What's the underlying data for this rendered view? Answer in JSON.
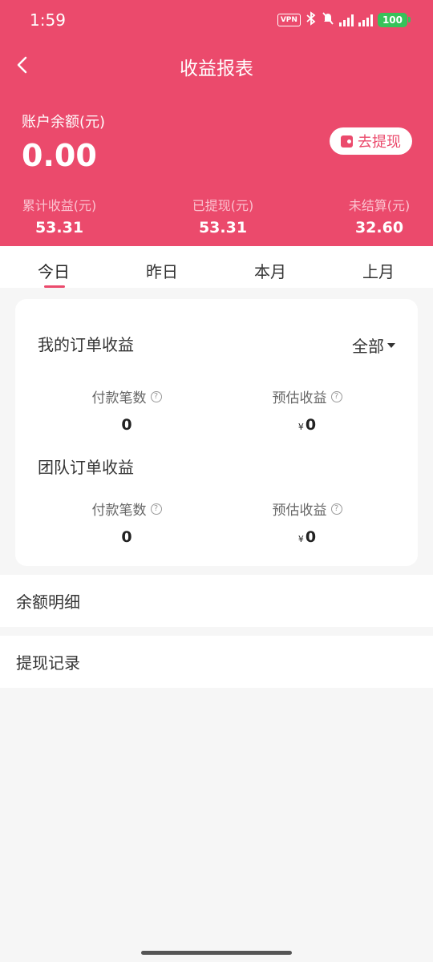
{
  "status_bar": {
    "time": "1:59",
    "vpn": "VPN",
    "battery": "100",
    "icons": [
      "vpn-icon",
      "bluetooth-icon",
      "mute-icon",
      "signal-icon",
      "signal-icon",
      "battery-icon"
    ]
  },
  "header": {
    "title": "收益报表",
    "back_icon": "chevron-left-icon",
    "balance_label": "账户余额(元)",
    "balance_value": "0.00",
    "withdraw_label": "去提现",
    "stats": [
      {
        "label": "累计收益(元)",
        "value": "53.31"
      },
      {
        "label": "已提现(元)",
        "value": "53.31"
      },
      {
        "label": "未结算(元)",
        "value": "32.60"
      }
    ]
  },
  "tabs": [
    {
      "label": "今日",
      "active": true
    },
    {
      "label": "昨日"
    },
    {
      "label": "本月"
    },
    {
      "label": "上月"
    }
  ],
  "card": {
    "my_orders_title": "我的订单收益",
    "filter_label": "全部",
    "my_orders": {
      "count_label": "付款笔数",
      "count_value": "0",
      "income_label": "预估收益",
      "income_currency": "¥",
      "income_value": "0"
    },
    "team_orders_title": "团队订单收益",
    "team_orders": {
      "count_label": "付款笔数",
      "count_value": "0",
      "income_label": "预估收益",
      "income_currency": "¥",
      "income_value": "0"
    }
  },
  "list": [
    {
      "label": "余额明细"
    },
    {
      "label": "提现记录"
    }
  ],
  "colors": {
    "primary": "#eb4a6c",
    "background": "#f6f6f6"
  }
}
